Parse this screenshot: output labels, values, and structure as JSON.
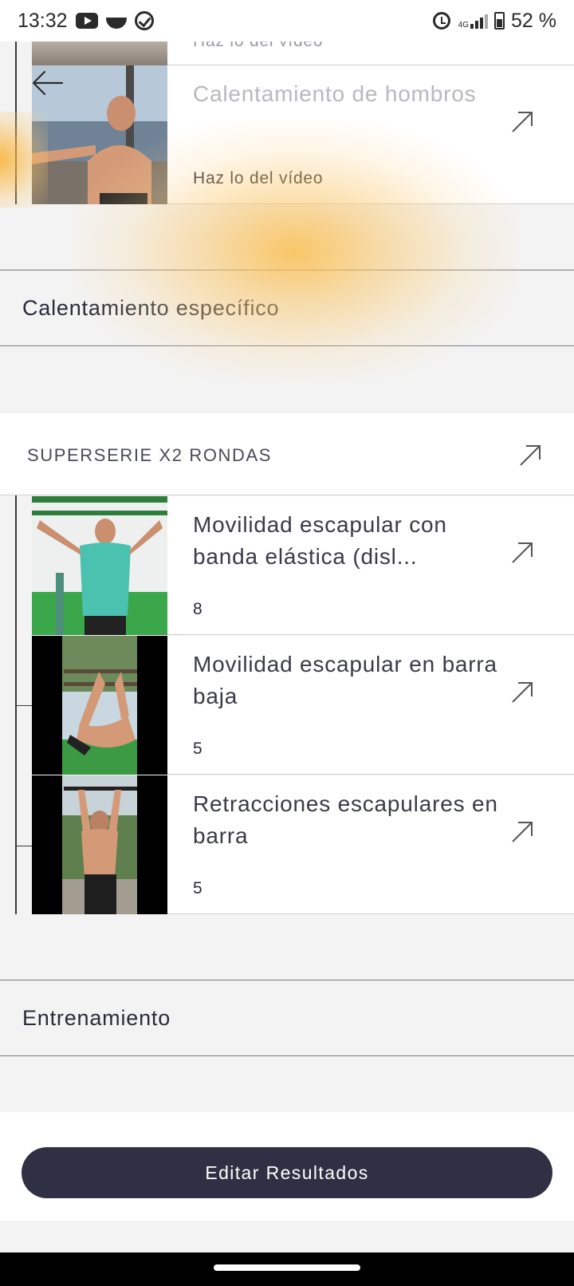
{
  "status_bar": {
    "time": "13:32",
    "battery": "52 %",
    "network": "4G",
    "icons": [
      "youtube-icon",
      "bowl-icon",
      "check-circle-icon",
      "alarm-icon",
      "signal-icon",
      "battery-icon"
    ]
  },
  "top_partial_row": {
    "subtitle": "Haz lo del vídeo"
  },
  "warmup_row": {
    "title": "Calentamiento de hombros",
    "subtitle": "Haz lo del vídeo"
  },
  "section_specific": {
    "title": "Calentamiento específico"
  },
  "superset": {
    "label": "SUPERSERIE X2 RONDAS",
    "exercises": [
      {
        "title": "Movilidad escapular con banda elástica (disl...",
        "reps": "8"
      },
      {
        "title": "Movilidad escapular en barra baja",
        "reps": "5"
      },
      {
        "title": "Retracciones escapulares en barra",
        "reps": "5"
      }
    ]
  },
  "section_training": {
    "title": "Entrenamiento"
  },
  "actions": {
    "edit_results": "Editar Resultados"
  },
  "colors": {
    "primary_button": "#2f3044",
    "background": "#f3f3f3",
    "accent_glow": "#fabe50"
  }
}
